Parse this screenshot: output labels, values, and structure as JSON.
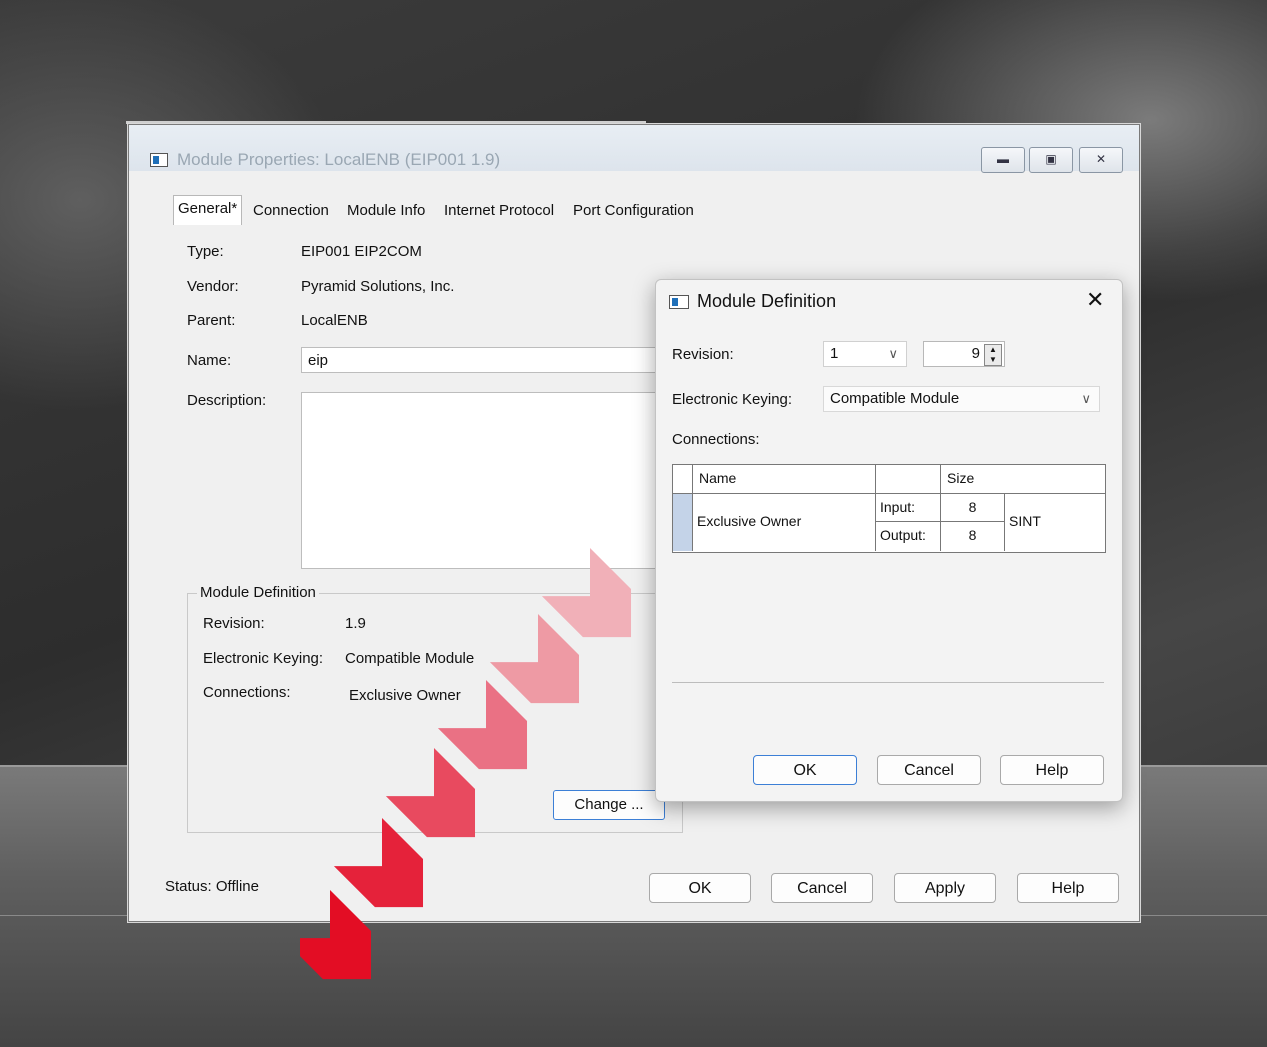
{
  "window": {
    "title": "Module Properties: LocalENB (EIP001 1.9)",
    "controls": [
      "minimize",
      "restore",
      "close"
    ]
  },
  "tabs": [
    {
      "label": "General*",
      "active": true
    },
    {
      "label": "Connection"
    },
    {
      "label": "Module Info"
    },
    {
      "label": "Internet Protocol"
    },
    {
      "label": "Port Configuration"
    }
  ],
  "general": {
    "type_label": "Type:",
    "type_value": "EIP001 EIP2COM",
    "vendor_label": "Vendor:",
    "vendor_value": "Pyramid Solutions, Inc.",
    "parent_label": "Parent:",
    "parent_value": "LocalENB",
    "name_label": "Name:",
    "name_value": "eip",
    "description_label": "Description:",
    "description_value": ""
  },
  "module_definition_group": {
    "title": "Module Definition",
    "revision_label": "Revision:",
    "revision_value": "1.9",
    "keying_label": "Electronic Keying:",
    "keying_value": "Compatible Module",
    "connections_label": "Connections:",
    "connections_value": "Exclusive Owner",
    "change_button": "Change ..."
  },
  "status": {
    "label": "Status:",
    "value": "Offline"
  },
  "footer_buttons": {
    "ok": "OK",
    "cancel": "Cancel",
    "apply": "Apply",
    "help": "Help"
  },
  "dialog": {
    "title": "Module Definition",
    "revision_label": "Revision:",
    "revision_major": "1",
    "revision_minor": "9",
    "keying_label": "Electronic Keying:",
    "keying_value": "Compatible Module",
    "connections_label": "Connections:",
    "table": {
      "headers": {
        "name": "Name",
        "blank": "",
        "size": "Size"
      },
      "row": {
        "name": "Exclusive Owner",
        "input_label": "Input:",
        "input_size": "8",
        "output_label": "Output:",
        "output_size": "8",
        "type": "SINT"
      }
    },
    "buttons": {
      "ok": "OK",
      "cancel": "Cancel",
      "help": "Help"
    }
  },
  "colors": {
    "accent_arrow": "#e30d24",
    "focus_border": "#3c7fd6"
  }
}
